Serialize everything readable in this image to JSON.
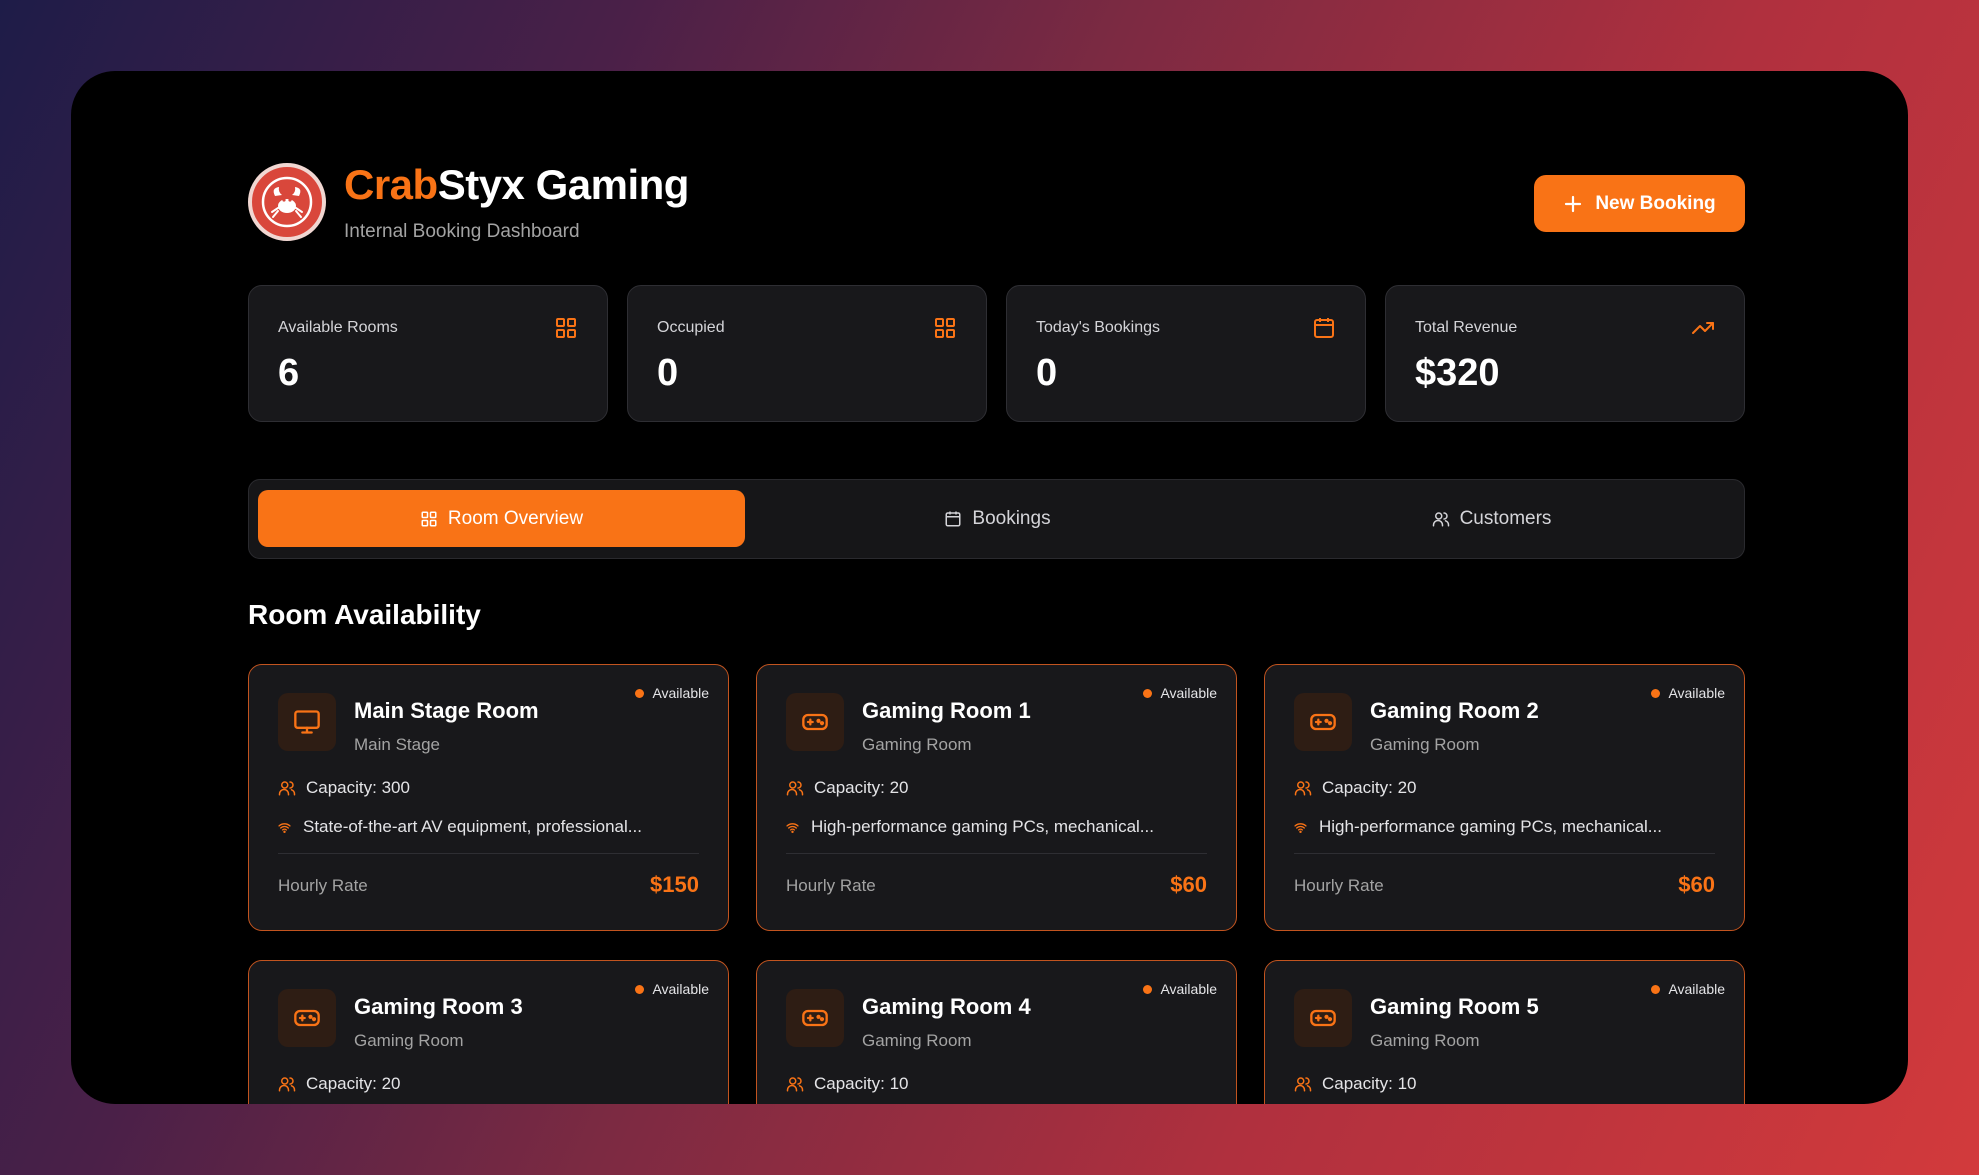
{
  "header": {
    "brand_accent": "Crab",
    "brand_rest": "Styx Gaming",
    "subtitle": "Internal Booking Dashboard",
    "new_booking_label": "New Booking"
  },
  "stats": [
    {
      "label": "Available Rooms",
      "value": "6",
      "icon": "grid-icon"
    },
    {
      "label": "Occupied",
      "value": "0",
      "icon": "grid-icon"
    },
    {
      "label": "Today's Bookings",
      "value": "0",
      "icon": "calendar-icon"
    },
    {
      "label": "Total Revenue",
      "value": "$320",
      "icon": "trending-up-icon"
    }
  ],
  "tabs": [
    {
      "label": "Room Overview",
      "icon": "grid-icon",
      "active": true
    },
    {
      "label": "Bookings",
      "icon": "calendar-icon",
      "active": false
    },
    {
      "label": "Customers",
      "icon": "users-icon",
      "active": false
    }
  ],
  "section_title": "Room Availability",
  "rooms": [
    {
      "name": "Main Stage Room",
      "type": "Main Stage",
      "status": "Available",
      "capacity": "Capacity: 300",
      "features": "State-of-the-art AV equipment, professional...",
      "rate_label": "Hourly Rate",
      "rate": "$150",
      "icon": "monitor-icon"
    },
    {
      "name": "Gaming Room 1",
      "type": "Gaming Room",
      "status": "Available",
      "capacity": "Capacity: 20",
      "features": "High-performance gaming PCs, mechanical...",
      "rate_label": "Hourly Rate",
      "rate": "$60",
      "icon": "gamepad-icon"
    },
    {
      "name": "Gaming Room 2",
      "type": "Gaming Room",
      "status": "Available",
      "capacity": "Capacity: 20",
      "features": "High-performance gaming PCs, mechanical...",
      "rate_label": "Hourly Rate",
      "rate": "$60",
      "icon": "gamepad-icon"
    },
    {
      "name": "Gaming Room 3",
      "type": "Gaming Room",
      "status": "Available",
      "capacity": "Capacity: 20",
      "icon": "gamepad-icon"
    },
    {
      "name": "Gaming Room 4",
      "type": "Gaming Room",
      "status": "Available",
      "capacity": "Capacity: 10",
      "icon": "gamepad-icon"
    },
    {
      "name": "Gaming Room 5",
      "type": "Gaming Room",
      "status": "Available",
      "capacity": "Capacity: 10",
      "icon": "gamepad-icon"
    }
  ],
  "colors": {
    "accent": "#f97316",
    "card_bg": "#18181b",
    "window_bg": "#000000"
  }
}
